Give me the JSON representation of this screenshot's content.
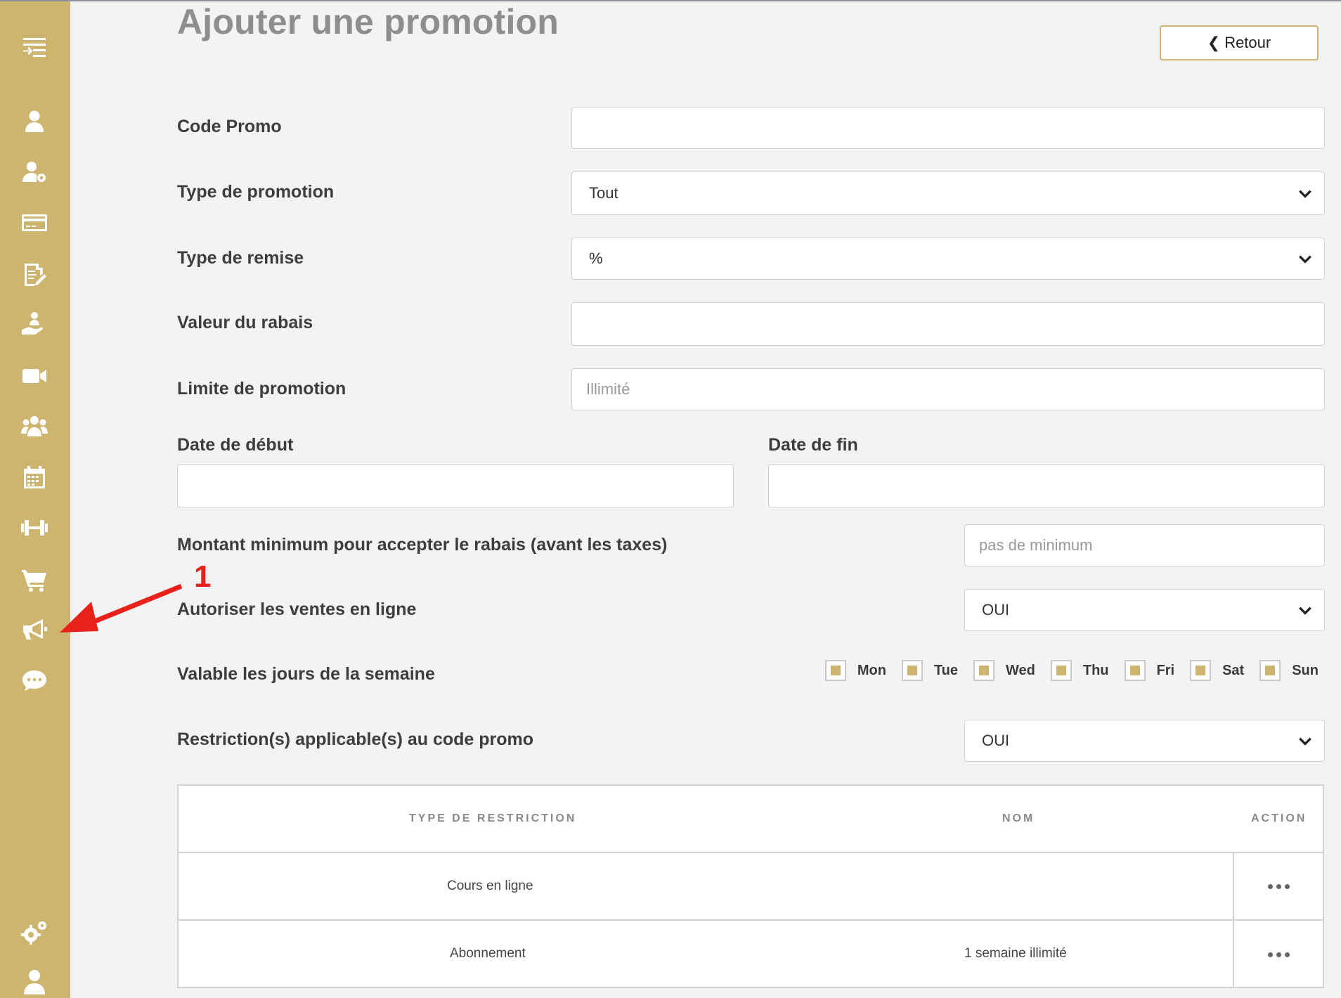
{
  "page": {
    "title": "Ajouter une promotion",
    "back_label": "Retour"
  },
  "sidebar": {
    "icons": [
      "menu-collapse-icon",
      "user-icon",
      "user-settings-icon",
      "credit-card-icon",
      "document-edit-icon",
      "hand-holding-person-icon",
      "video-camera-icon",
      "users-group-icon",
      "calendar-icon",
      "dumbbell-icon",
      "shopping-cart-icon",
      "megaphone-icon",
      "chat-bubble-icon",
      "gears-icon",
      "user-profile-icon"
    ]
  },
  "form": {
    "code_promo": {
      "label": "Code Promo",
      "value": ""
    },
    "type_promotion": {
      "label": "Type de promotion",
      "value": "Tout"
    },
    "type_remise": {
      "label": "Type de remise",
      "value": "%"
    },
    "valeur_rabais": {
      "label": "Valeur du rabais",
      "value": ""
    },
    "limite_promotion": {
      "label": "Limite de promotion",
      "placeholder": "Illimité"
    },
    "date_debut": {
      "label": "Date de début",
      "value": ""
    },
    "date_fin": {
      "label": "Date de fin",
      "value": ""
    },
    "montant_minimum": {
      "label": "Montant minimum pour accepter le rabais (avant les taxes)",
      "placeholder": "pas de minimum"
    },
    "ventes_en_ligne": {
      "label": "Autoriser les ventes en ligne",
      "value": "OUI"
    },
    "jours_semaine": {
      "label": "Valable les jours de la semaine",
      "days": [
        "Mon",
        "Tue",
        "Wed",
        "Thu",
        "Fri",
        "Sat",
        "Sun"
      ]
    },
    "restrictions": {
      "label": "Restriction(s) applicable(s) au code promo",
      "value": "OUI"
    }
  },
  "table": {
    "headers": [
      "TYPE DE RESTRICTION",
      "NOM",
      "ACTION"
    ],
    "rows": [
      {
        "type": "Cours en ligne",
        "nom": ""
      },
      {
        "type": "Abonnement",
        "nom": "1 semaine illimité"
      }
    ]
  },
  "annotation": {
    "number": "1"
  },
  "colors": {
    "accent": "#cdb46f",
    "annotation": "#e8221b"
  }
}
